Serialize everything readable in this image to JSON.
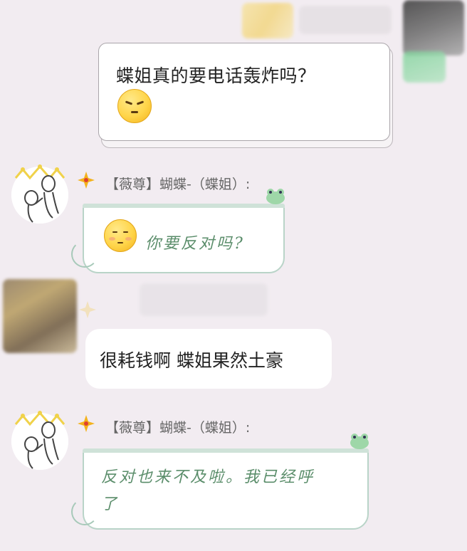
{
  "messages": [
    {
      "type": "quoted-card",
      "text": "蝶姐真的要电话轰炸吗？",
      "emoji": "squinting-face-emoji"
    },
    {
      "type": "decorated",
      "sender": "【薇尊】蝴蝶-（蝶姐）:",
      "text": "你要反对吗?",
      "emoji": "blushing-face-emoji"
    },
    {
      "type": "plain",
      "text": "很耗钱啊 蝶姐果然土豪"
    },
    {
      "type": "decorated",
      "sender": "【薇尊】蝴蝶-（蝶姐）:",
      "text_line1": "反对也来不及啦。我已经呼",
      "text_line2": "了"
    }
  ],
  "colors": {
    "background": "#f2ecf1",
    "bubble": "#ffffff",
    "note_border": "#b9d4c8",
    "handwriting": "#5a8d6a"
  }
}
